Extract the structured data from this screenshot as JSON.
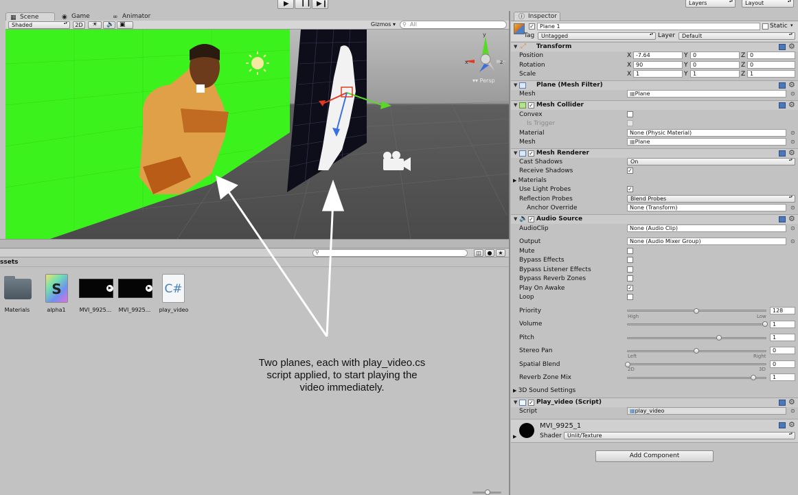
{
  "toolbar": {
    "play_icon": "play-icon",
    "pause_icon": "pause-icon",
    "step_icon": "step-icon",
    "layers_label": "Layers",
    "layout_label": "Layout"
  },
  "scene_tabs": {
    "scene": "Scene",
    "game": "Game",
    "animator": "Animator"
  },
  "scene_toolbar": {
    "shading": "Shaded",
    "mode_2d": "2D",
    "gizmos": "Gizmos",
    "search_placeholder": "All",
    "persp_label": "Persp"
  },
  "gizmo_axes": {
    "x": "x",
    "y": "y",
    "z": "z"
  },
  "project": {
    "title": "ssets",
    "assets": [
      {
        "name": "Materials",
        "icon": "folder-icon"
      },
      {
        "name": "alpha1",
        "icon": "shader-icon"
      },
      {
        "name": "MVI_9925...",
        "icon": "video-icon"
      },
      {
        "name": "MVI_9925...",
        "icon": "video-icon"
      },
      {
        "name": "play_video",
        "icon": "csharp-script-icon"
      }
    ],
    "script_badge": "C#",
    "shader_badge": "S"
  },
  "annotation": {
    "lines": [
      "Two planes, each with play_video.cs",
      "script applied, to start playing the",
      "video immediately."
    ]
  },
  "inspector": {
    "tab": "Inspector",
    "object_name": "Plane 1",
    "static_label": "Static",
    "tag_label": "Tag",
    "tag_value": "Untagged",
    "layer_label": "Layer",
    "layer_value": "Default",
    "transform": {
      "title": "Transform",
      "position_label": "Position",
      "rotation_label": "Rotation",
      "scale_label": "Scale",
      "axis_x": "X",
      "axis_y": "Y",
      "axis_z": "Z",
      "position": {
        "x": "-7.64",
        "y": "0",
        "z": "0"
      },
      "rotation": {
        "x": "90",
        "y": "0",
        "z": "0"
      },
      "scale": {
        "x": "1",
        "y": "1",
        "z": "1"
      }
    },
    "mesh_filter": {
      "title": "Plane (Mesh Filter)",
      "mesh_label": "Mesh",
      "mesh_value": "Plane"
    },
    "mesh_collider": {
      "title": "Mesh Collider",
      "convex_label": "Convex",
      "is_trigger_label": "Is Trigger",
      "material_label": "Material",
      "material_value": "None (Physic Material)",
      "mesh_label": "Mesh",
      "mesh_value": "Plane"
    },
    "mesh_renderer": {
      "title": "Mesh Renderer",
      "cast_shadows_label": "Cast Shadows",
      "cast_shadows_value": "On",
      "receive_shadows_label": "Receive Shadows",
      "materials_label": "Materials",
      "light_probes_label": "Use Light Probes",
      "reflection_probes_label": "Reflection Probes",
      "reflection_probes_value": "Blend Probes",
      "anchor_override_label": "Anchor Override",
      "anchor_override_value": "None (Transform)"
    },
    "audio_source": {
      "title": "Audio Source",
      "audioclip_label": "AudioClip",
      "audioclip_value": "None (Audio Clip)",
      "output_label": "Output",
      "output_value": "None (Audio Mixer Group)",
      "mute_label": "Mute",
      "bypass_effects_label": "Bypass Effects",
      "bypass_listener_label": "Bypass Listener Effects",
      "bypass_reverb_label": "Bypass Reverb Zones",
      "play_on_awake_label": "Play On Awake",
      "loop_label": "Loop",
      "priority_label": "Priority",
      "priority_value": "128",
      "priority_high": "High",
      "priority_low": "Low",
      "volume_label": "Volume",
      "volume_value": "1",
      "pitch_label": "Pitch",
      "pitch_value": "1",
      "stereo_pan_label": "Stereo Pan",
      "stereo_pan_value": "0",
      "stereo_left": "Left",
      "stereo_right": "Right",
      "spatial_blend_label": "Spatial Blend",
      "spatial_blend_value": "0",
      "spatial_2d": "2D",
      "spatial_3d": "3D",
      "reverb_mix_label": "Reverb Zone Mix",
      "reverb_mix_value": "1",
      "sound_settings_label": "3D Sound Settings"
    },
    "play_video": {
      "title": "Play_video (Script)",
      "script_label": "Script",
      "script_value": "play_video"
    },
    "material": {
      "name": "MVI_9925_1",
      "shader_label": "Shader",
      "shader_value": "Unlit/Texture"
    },
    "add_component": "Add Component"
  }
}
